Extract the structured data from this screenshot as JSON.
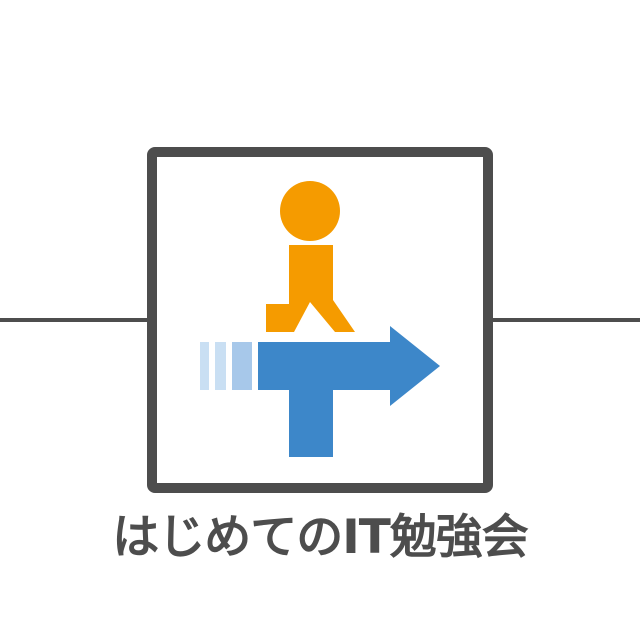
{
  "logo": {
    "title": "はじめてのIT勉強会",
    "colors": {
      "frame": "#4d4d4d",
      "person": "#f59b00",
      "arrow": "#3d87c9",
      "trail_light": "#c9dff3",
      "trail_mid": "#a7c8ea",
      "text": "#4d4d4d"
    },
    "icons": [
      "person-icon",
      "arrow-right-icon",
      "t-shape-icon"
    ]
  }
}
